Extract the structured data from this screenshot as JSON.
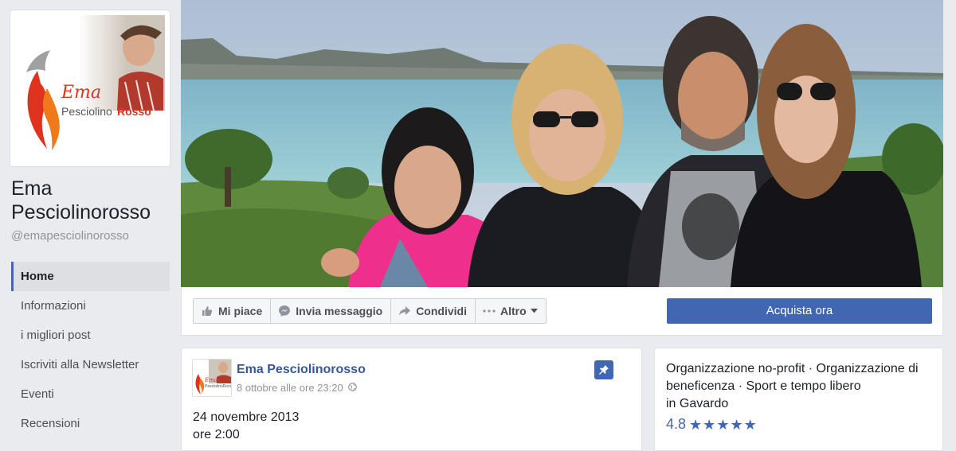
{
  "page": {
    "name": "Ema Pesciolinorosso",
    "handle": "@emapesciolinorosso",
    "logo_text": {
      "script": "Ema",
      "word1": "Pesciolino",
      "word2": "Rosso"
    }
  },
  "sidebar": {
    "items": [
      {
        "label": "Home",
        "active": true
      },
      {
        "label": "Informazioni"
      },
      {
        "label": "i migliori post"
      },
      {
        "label": "Iscriviti alla Newsletter"
      },
      {
        "label": "Eventi"
      },
      {
        "label": "Recensioni"
      }
    ]
  },
  "actions": {
    "like": "Mi piace",
    "message": "Invia messaggio",
    "share": "Condividi",
    "more": "Altro",
    "buy": "Acquista ora"
  },
  "post": {
    "author": "Ema Pesciolinorosso",
    "timestamp": "8 ottobre alle ore 23:20",
    "line1": "24 novembre 2013",
    "line2": "ore 2:00"
  },
  "info": {
    "categories": "Organizzazione no-profit · Organizzazione di beneficenza · Sport e tempo libero",
    "location": "in Gavardo",
    "rating": "4.8",
    "stars": 5
  },
  "icons": {
    "like": "thumbs-up-icon",
    "message": "messenger-icon",
    "share": "share-arrow-icon",
    "more": "more-dots-icon",
    "pin": "pin-icon",
    "privacy": "globe-icon"
  },
  "colors": {
    "brand_blue": "#4267b2",
    "link_blue": "#365899",
    "background": "#e9ebee"
  }
}
